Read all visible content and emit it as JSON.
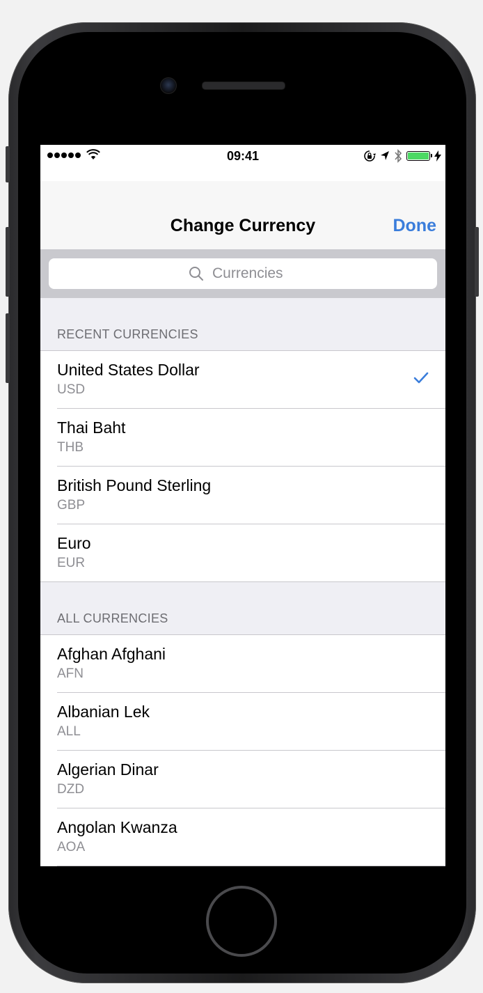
{
  "status_bar": {
    "time": "09:41",
    "signal_dots": 5,
    "battery_level": 1.0,
    "battery_color": "#4cd964"
  },
  "nav": {
    "title": "Change Currency",
    "done_label": "Done",
    "accent_color": "#3a7ddb"
  },
  "search": {
    "placeholder": "Currencies",
    "value": ""
  },
  "sections": [
    {
      "header": "RECENT CURRENCIES",
      "items": [
        {
          "name": "United States Dollar",
          "code": "USD",
          "selected": true
        },
        {
          "name": "Thai Baht",
          "code": "THB",
          "selected": false
        },
        {
          "name": "British Pound Sterling",
          "code": "GBP",
          "selected": false
        },
        {
          "name": "Euro",
          "code": "EUR",
          "selected": false
        }
      ]
    },
    {
      "header": "ALL CURRENCIES",
      "items": [
        {
          "name": "Afghan Afghani",
          "code": "AFN",
          "selected": false
        },
        {
          "name": "Albanian Lek",
          "code": "ALL",
          "selected": false
        },
        {
          "name": "Algerian Dinar",
          "code": "DZD",
          "selected": false
        },
        {
          "name": "Angolan Kwanza",
          "code": "AOA",
          "selected": false
        }
      ]
    }
  ]
}
